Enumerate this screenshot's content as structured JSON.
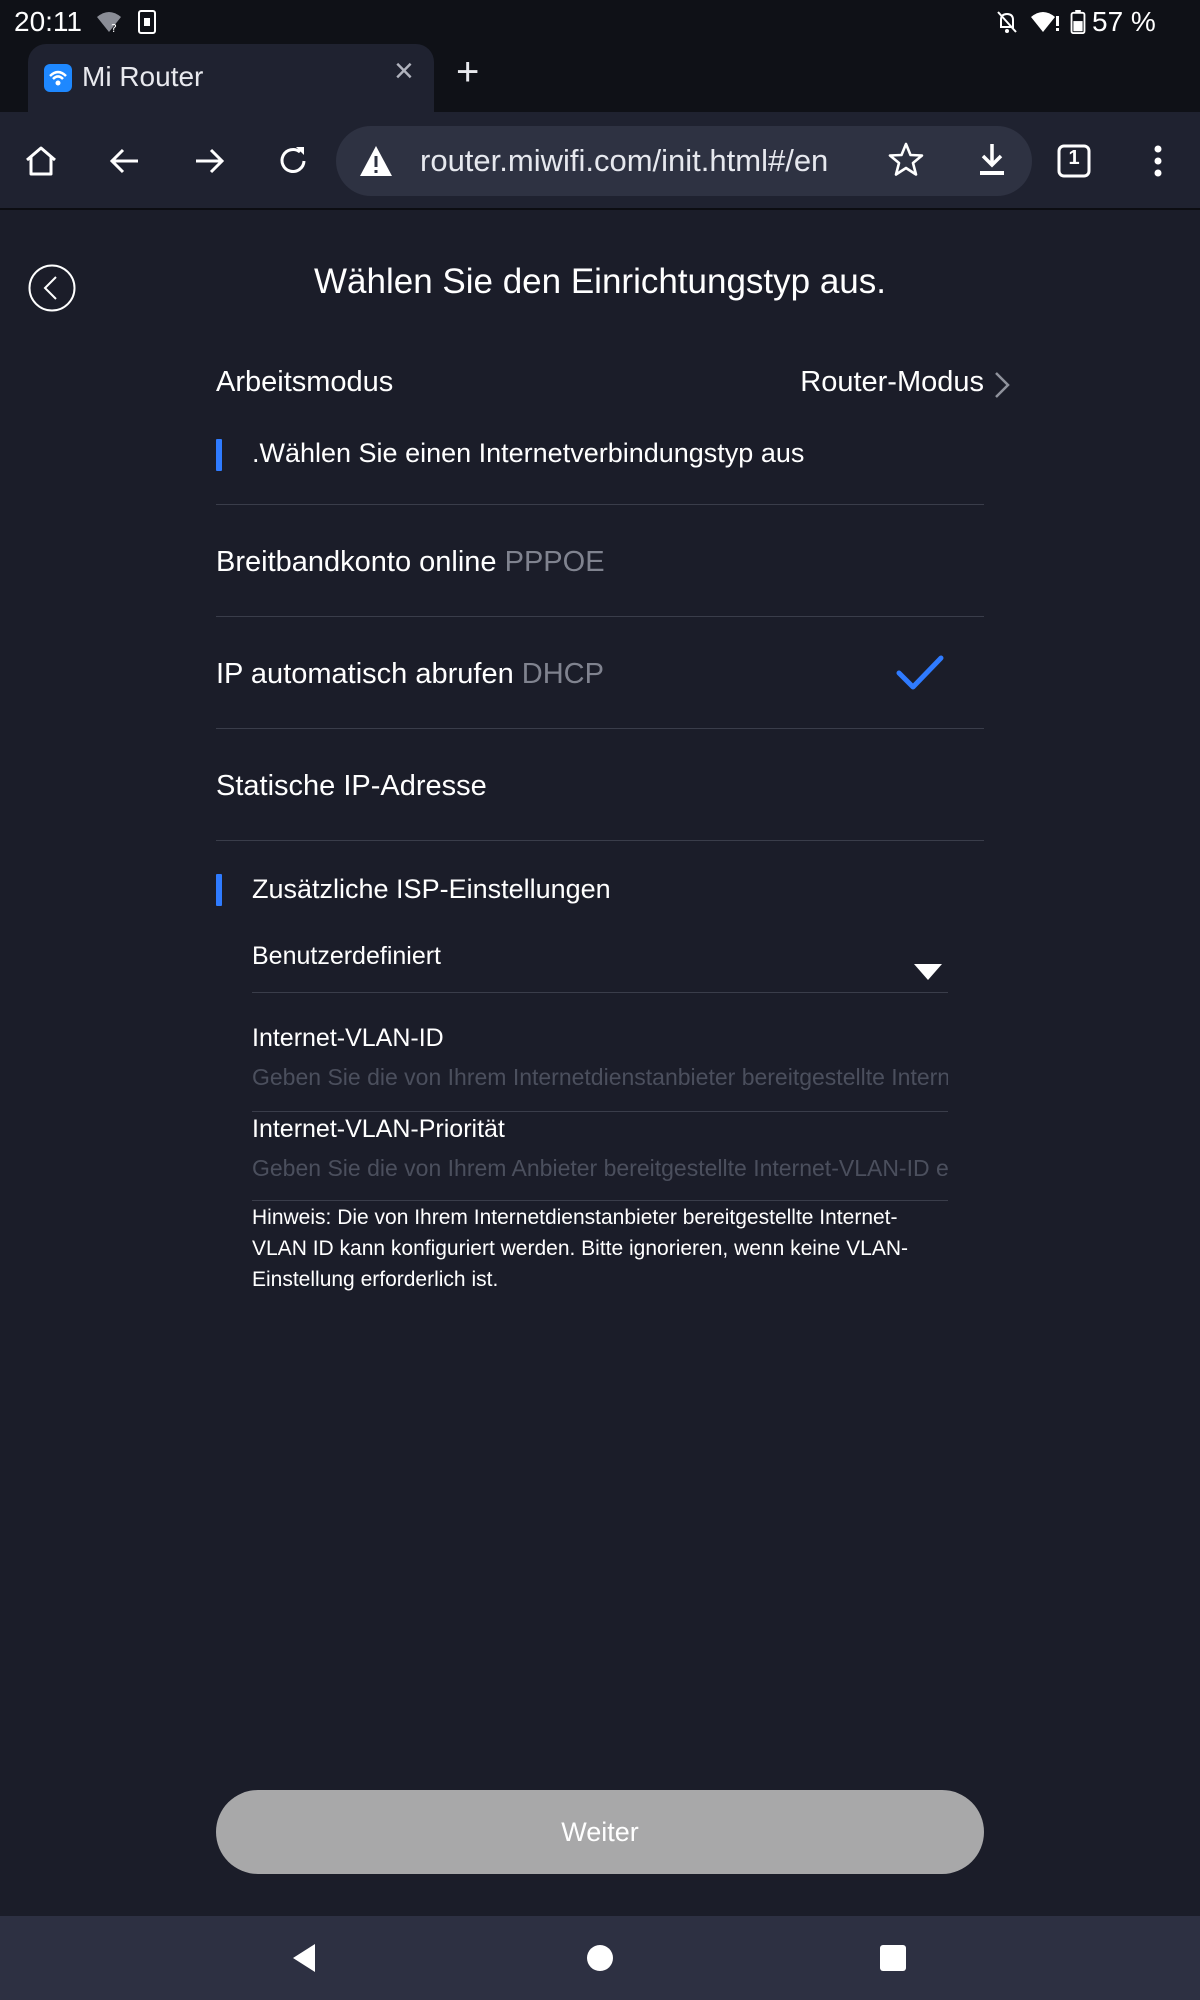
{
  "status_bar": {
    "time": "20:11",
    "battery": "57 %",
    "icons": [
      "wifi-question-icon",
      "sim-icon",
      "bell-off-icon",
      "wifi-alert-icon",
      "battery-icon"
    ]
  },
  "browser": {
    "tab_title": "Mi Router",
    "tab_count": "1",
    "url": "router.miwifi.com/init.html#/en"
  },
  "page": {
    "title": "Wählen Sie den Einrichtungstyp aus.",
    "work_mode": {
      "label": "Arbeitsmodus",
      "value": "Router-Modus"
    },
    "connection_section": {
      "title": ".Wählen Sie einen Internetverbindungstyp aus",
      "options": [
        {
          "label": "Breitbandkonto online",
          "code": "PPPOE",
          "selected": false
        },
        {
          "label": "IP automatisch abrufen",
          "code": "DHCP",
          "selected": true
        },
        {
          "label": "Statische IP-Adresse",
          "code": "",
          "selected": false
        }
      ]
    },
    "isp_section": {
      "title": "Zusätzliche ISP-Einstellungen",
      "select_value": "Benutzerdefiniert",
      "vlan_id": {
        "label": "Internet-VLAN-ID",
        "placeholder": "Geben Sie die von Ihrem Internetdienstanbieter bereitgestellte Internet-VLAN-ID ein"
      },
      "vlan_priority": {
        "label": "Internet-VLAN-Priorität",
        "placeholder": "Geben Sie die von Ihrem Anbieter bereitgestellte Internet-VLAN-ID ein"
      },
      "hint": "Hinweis: Die von Ihrem Internetdienstanbieter bereitgestellte Internet-VLAN ID kann konfiguriert werden. Bitte ignorieren, wenn keine VLAN-Einstellung erforderlich ist."
    },
    "next_button": "Weiter"
  },
  "colors": {
    "background": "#1b1d29",
    "accent": "#2f7bff",
    "button_disabled": "#a8a8a9",
    "muted_text": "#80838f"
  }
}
